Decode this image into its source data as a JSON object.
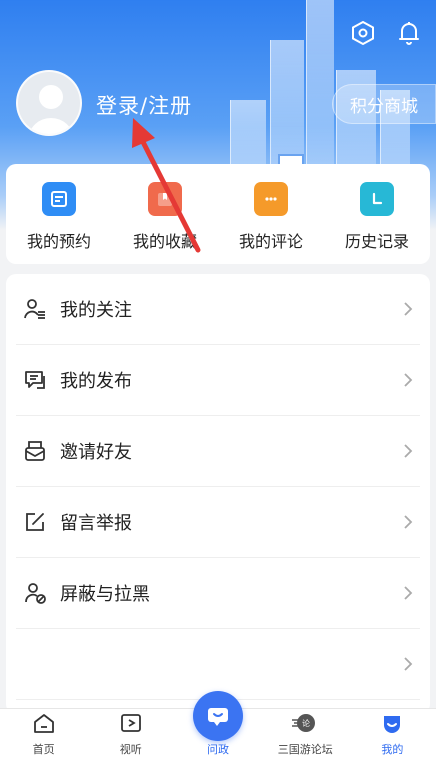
{
  "header": {
    "login_label": "登录/注册",
    "points_label": "积分商城",
    "icons": [
      "settings-hex-icon",
      "bell-icon"
    ]
  },
  "quick": [
    {
      "label": "我的预约",
      "icon": "appointment-icon",
      "color": "#2f8df5"
    },
    {
      "label": "我的收藏",
      "icon": "bookmark-icon",
      "color": "#f06a4c"
    },
    {
      "label": "我的评论",
      "icon": "comment-icon",
      "color": "#f59a2a"
    },
    {
      "label": "历史记录",
      "icon": "history-icon",
      "color": "#27b8d6"
    }
  ],
  "menu": [
    {
      "label": "我的关注",
      "icon": "follow-user-icon"
    },
    {
      "label": "我的发布",
      "icon": "publish-chat-icon"
    },
    {
      "label": "邀请好友",
      "icon": "invite-envelope-icon"
    },
    {
      "label": "留言举报",
      "icon": "report-edit-icon"
    },
    {
      "label": "屏蔽与拉黑",
      "icon": "block-user-icon"
    },
    {
      "label": "",
      "icon": ""
    }
  ],
  "tabs": [
    {
      "label": "首页",
      "icon": "home-icon",
      "active": false
    },
    {
      "label": "视听",
      "icon": "video-play-icon",
      "active": false
    },
    {
      "label": "问政",
      "icon": "wenzheng-chat-icon",
      "active": false
    },
    {
      "label": "三国游论坛",
      "icon": "sanguo-forum-icon",
      "active": false
    },
    {
      "label": "我的",
      "icon": "me-icon",
      "active": true
    }
  ],
  "colors": {
    "accent": "#2f6bf0",
    "header_blue": "#2f7ff0",
    "annotation_red": "#e53935"
  }
}
